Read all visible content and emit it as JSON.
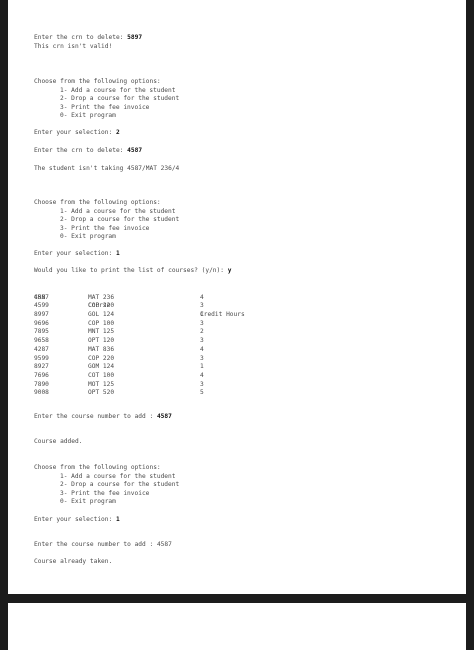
{
  "s1": {
    "prompt": "Enter the crn to delete: ",
    "value": "5897",
    "msg": "This crn isn't valid!"
  },
  "menu": {
    "title": "Choose from the following options:",
    "items": [
      "1- Add a course for the student",
      "2- Drop a course for the student",
      "3- Print the fee invoice",
      "0- Exit program"
    ]
  },
  "sel_prompt": "Enter your selection: ",
  "s2": {
    "sel": "2",
    "crn_prompt": "Enter the crn to delete: ",
    "crn": "4587",
    "msg": "The student isn't taking 4587/MAT 236/4"
  },
  "s3": {
    "sel": "1",
    "print_prompt": "Would you like to print the list of courses? (y/n): ",
    "print_ans": "y"
  },
  "table": {
    "headers": [
      "CRN",
      "Course",
      "Credit Hours"
    ],
    "rows": [
      [
        "4587",
        "MAT 236",
        "4"
      ],
      [
        "4599",
        "COP 220",
        "3"
      ],
      [
        "8997",
        "GOL 124",
        "1"
      ],
      [
        "9696",
        "COP 100",
        "3"
      ],
      [
        "7895",
        "MNT 125",
        "2"
      ],
      [
        "9658",
        "OPT 120",
        "3"
      ],
      [
        "4287",
        "MAT 836",
        "4"
      ],
      [
        "9599",
        "COP 220",
        "3"
      ],
      [
        "8927",
        "GOM 124",
        "1"
      ],
      [
        "7696",
        "COT 100",
        "4"
      ],
      [
        "7890",
        "MOT 125",
        "3"
      ],
      [
        "9008",
        "OPT 520",
        "5"
      ]
    ]
  },
  "s4": {
    "add_prompt": "Enter the course number to add : ",
    "add_value": "4587",
    "msg": "Course added."
  },
  "s5": {
    "sel": "1",
    "add_prompt": "Enter the course number to add : ",
    "add_value": "4587",
    "msg": "Course already taken."
  }
}
